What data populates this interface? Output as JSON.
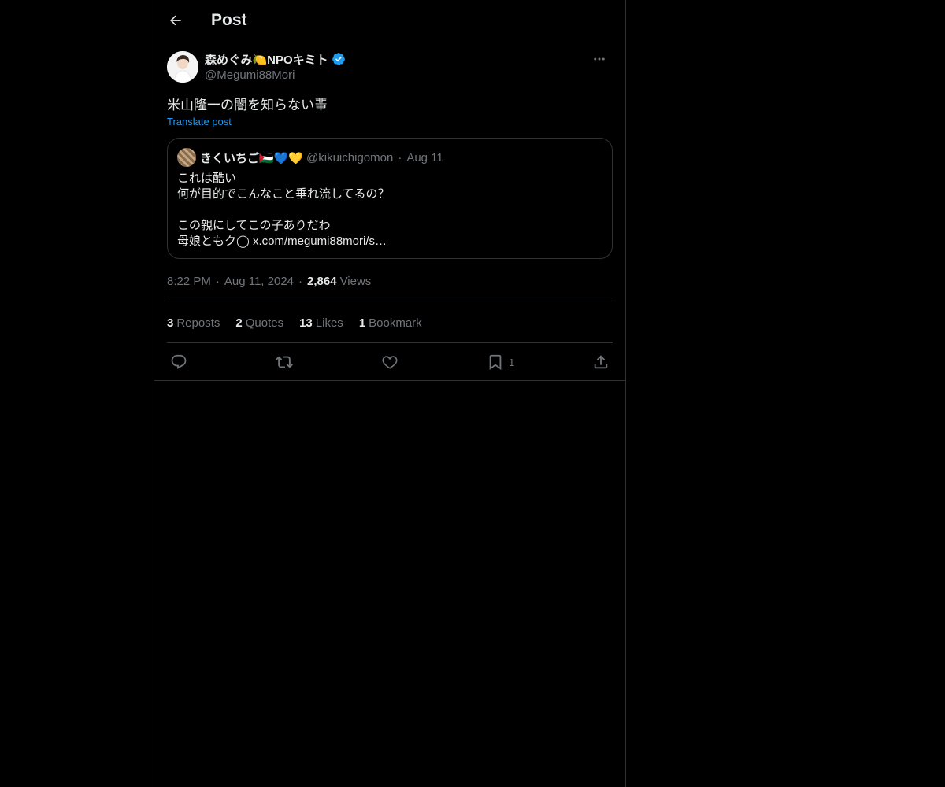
{
  "header": {
    "title": "Post"
  },
  "author": {
    "display_name": "森めぐみ🍋NPOキミト",
    "handle": "@Megumi88Mori"
  },
  "post": {
    "text": "米山隆一の闇を知らない輩",
    "translate_label": "Translate post"
  },
  "quote": {
    "display_name": "きくいちご🇵🇸💙💛",
    "handle": "@kikuichigomon",
    "separator": "·",
    "date": "Aug 11",
    "lines": [
      "これは酷い",
      "何が目的でこんなこと垂れ流してるの？",
      "",
      "この親にしてこの子ありだわ",
      "母娘ともク◯ x.com/megumi88mori/s…"
    ]
  },
  "meta": {
    "time": "8:22 PM",
    "separator": "·",
    "date": "Aug 11, 2024",
    "views_count": "2,864",
    "views_label": "Views"
  },
  "stats": {
    "reposts_count": "3",
    "reposts_label": "Reposts",
    "quotes_count": "2",
    "quotes_label": "Quotes",
    "likes_count": "13",
    "likes_label": "Likes",
    "bookmarks_count": "1",
    "bookmarks_label": "Bookmark"
  },
  "actions": {
    "icons": [
      "reply-icon",
      "repost-icon",
      "like-icon",
      "bookmark-icon",
      "share-icon"
    ],
    "bookmark_count": "1"
  },
  "colors": {
    "background": "#000000",
    "text": "#e7e9ea",
    "muted": "#71767b",
    "accent": "#1d9bf0",
    "border": "#2f3336"
  }
}
